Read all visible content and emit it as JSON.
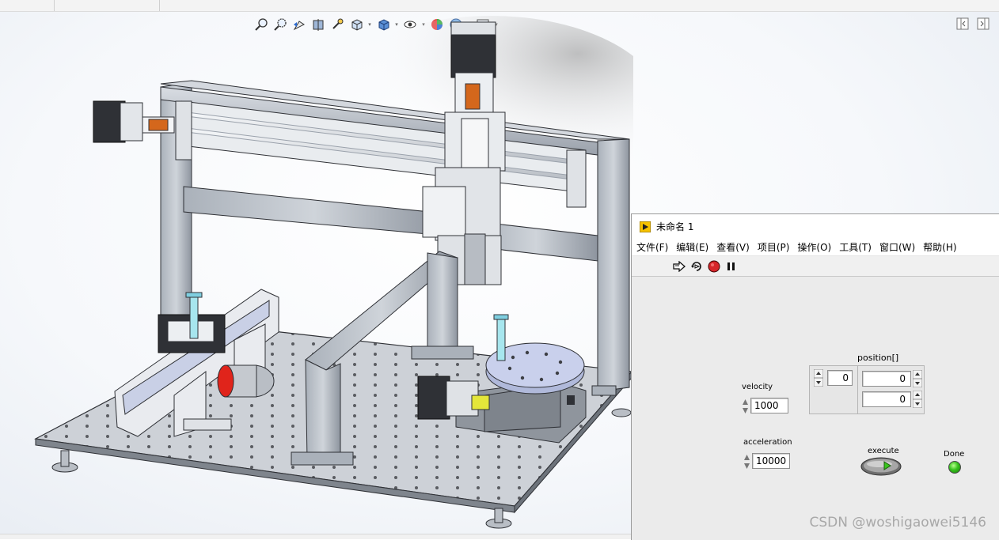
{
  "labview": {
    "title": "未命名 1",
    "menu": [
      "文件(F)",
      "编辑(E)",
      "查看(V)",
      "项目(P)",
      "操作(O)",
      "工具(T)",
      "窗口(W)",
      "帮助(H)"
    ],
    "run_toolbar": [
      "run-arrow-icon",
      "run-continuously-icon",
      "abort-icon",
      "pause-icon"
    ],
    "controls": {
      "velocity": {
        "label": "velocity",
        "value": "1000"
      },
      "acceleration": {
        "label": "acceleration",
        "value": "10000"
      },
      "position": {
        "label": "position[]",
        "index": "0",
        "values": [
          "0",
          "0"
        ]
      },
      "execute": {
        "label": "execute"
      },
      "done": {
        "label": "Done",
        "state": "on",
        "color": "#35c21b"
      }
    }
  },
  "cad": {
    "view_toolbar_icons": [
      "zoom-to-fit-icon",
      "zoom-to-area-icon",
      "previous-view-icon",
      "section-view-icon",
      "dynamic-annotation-icon",
      "view-orientation-icon",
      "display-style-icon",
      "hide-show-icon",
      "edit-appearance-icon",
      "apply-scene-icon",
      "view-settings-icon"
    ],
    "window_icons": [
      "tile-left-icon",
      "tile-right-icon"
    ]
  },
  "watermark": "CSDN @woshigaowei5146"
}
